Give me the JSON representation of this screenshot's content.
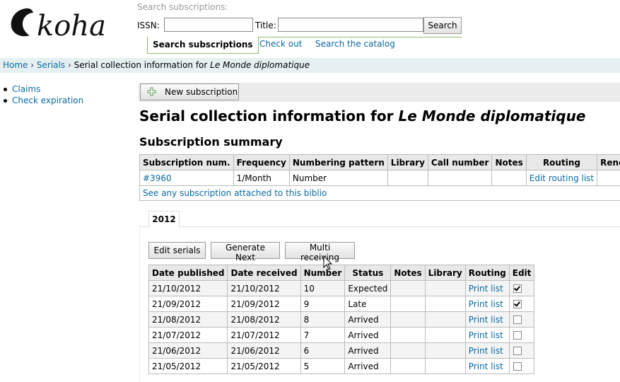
{
  "header": {
    "logo_text": "koha",
    "search_label": "Search subscriptions:",
    "issn_label": "ISSN:",
    "issn_value": "",
    "title_label": "Title:",
    "title_value": "",
    "search_button": "Search",
    "tabs": [
      {
        "label": "Search subscriptions",
        "active": true
      },
      {
        "label": "Check out",
        "active": false
      },
      {
        "label": "Search the catalog",
        "active": false
      }
    ]
  },
  "breadcrumb": {
    "home": "Home",
    "serials": "Serials",
    "sep": "›",
    "current_prefix": "Serial collection information for",
    "current_title": "Le Monde diplomatique"
  },
  "sidebar": {
    "items": [
      {
        "label": "Claims"
      },
      {
        "label": "Check expiration"
      }
    ]
  },
  "toolbar": {
    "new_subscription": "New subscription"
  },
  "page": {
    "title_prefix": "Serial collection information for",
    "title_italic": "Le Monde diplomatique",
    "summary_title": "Subscription summary"
  },
  "summary_table": {
    "headers": [
      "Subscription num.",
      "Frequency",
      "Numbering pattern",
      "Library",
      "Call number",
      "Notes",
      "Routing",
      "Renew"
    ],
    "row": {
      "subscription_num": "#3960",
      "frequency": "1/Month",
      "numbering_pattern": "Number",
      "library": "",
      "call_number": "",
      "notes": "",
      "routing": "Edit routing list",
      "renew": ""
    },
    "footer_link": "See any subscription attached to this biblio"
  },
  "year_tab": "2012",
  "buttons": {
    "edit_serials": "Edit serials",
    "generate_next": "Generate Next",
    "multi_receiving": "Multi receiving"
  },
  "issues_table": {
    "headers": [
      "Date published",
      "Date received",
      "Number",
      "Status",
      "Notes",
      "Library",
      "Routing",
      "Edit"
    ],
    "rows": [
      {
        "published": "21/10/2012",
        "received": "21/10/2012",
        "number": "10",
        "status": "Expected",
        "notes": "",
        "library": "",
        "routing": "Print list",
        "edit": true
      },
      {
        "published": "21/09/2012",
        "received": "21/09/2012",
        "number": "9",
        "status": "Late",
        "notes": "",
        "library": "",
        "routing": "Print list",
        "edit": true
      },
      {
        "published": "21/08/2012",
        "received": "21/08/2012",
        "number": "8",
        "status": "Arrived",
        "notes": "",
        "library": "",
        "routing": "Print list",
        "edit": false
      },
      {
        "published": "21/07/2012",
        "received": "21/07/2012",
        "number": "7",
        "status": "Arrived",
        "notes": "",
        "library": "",
        "routing": "Print list",
        "edit": false
      },
      {
        "published": "21/06/2012",
        "received": "21/06/2012",
        "number": "6",
        "status": "Arrived",
        "notes": "",
        "library": "",
        "routing": "Print list",
        "edit": false
      },
      {
        "published": "21/05/2012",
        "received": "21/05/2012",
        "number": "5",
        "status": "Arrived",
        "notes": "",
        "library": "",
        "routing": "Print list",
        "edit": false
      }
    ]
  },
  "colors": {
    "link": "#0a6aa1",
    "breadcrumb_bg": "#e6f0f2",
    "tab_border": "#8fbc6a"
  },
  "icons": {
    "logo": "koha-logo",
    "new_subscription": "plus-icon",
    "cursor": "mouse-pointer-icon"
  }
}
